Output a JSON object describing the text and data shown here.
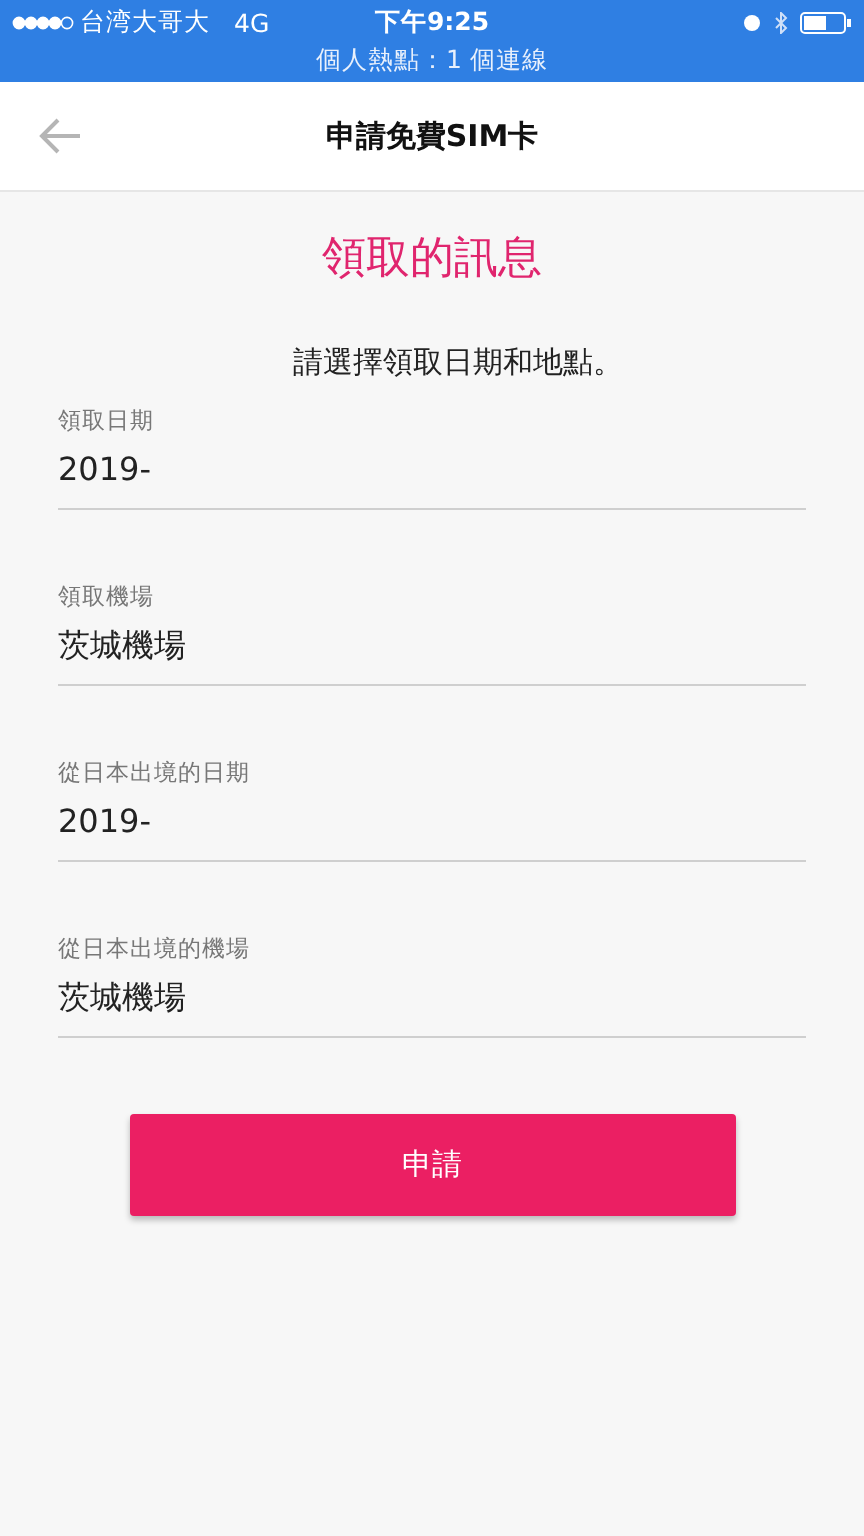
{
  "status_bar": {
    "carrier": "台湾大哥大",
    "network": "4G",
    "time": "下午9:25",
    "hotspot": "個人熱點：1 個連線"
  },
  "header": {
    "title": "申請免費SIM卡"
  },
  "heading": "領取的訊息",
  "instruction": "請選擇領取日期和地點。",
  "fields": [
    {
      "label": "領取日期",
      "value": "2019-"
    },
    {
      "label": "領取機場",
      "value": "茨城機場"
    },
    {
      "label": "從日本出境的日期",
      "value": "2019-"
    },
    {
      "label": "從日本出境的機場",
      "value": "茨城機場"
    }
  ],
  "submit_button": "申請"
}
